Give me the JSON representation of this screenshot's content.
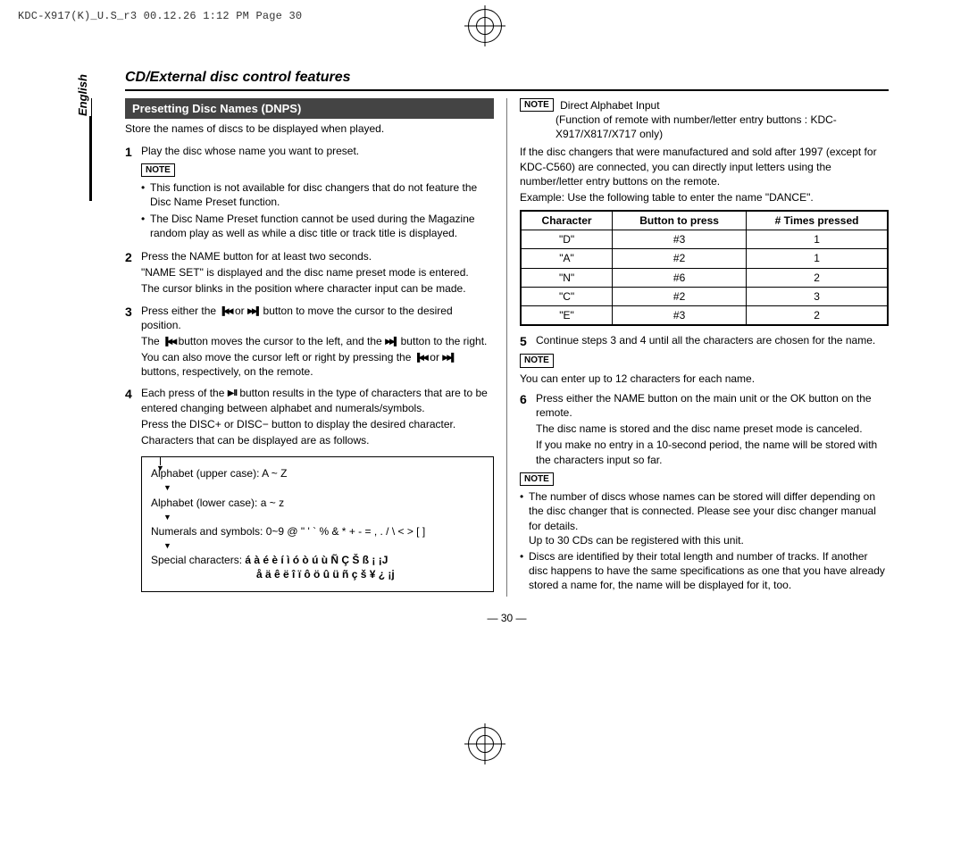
{
  "printmark": "KDC-X917(K)_U.S_r3  00.12.26 1:12 PM  Page 30",
  "language": "English",
  "section_title": "CD/External disc control features",
  "subhead": "Presetting Disc Names (DNPS)",
  "intro": "Store the names of discs to be displayed when played.",
  "note_label": "NOTE",
  "left": {
    "s1": "Play the disc whose name you want to preset.",
    "n1a": "This function is not available for disc changers that do not feature the Disc Name Preset function.",
    "n1b": "The Disc Name Preset function cannot be used during the Magazine random play as well as while a disc title or track title is displayed.",
    "s2a": "Press the NAME button for at least two seconds.",
    "s2b": "\"NAME SET\" is displayed and the disc name preset mode is entered.",
    "s2c": "The cursor blinks in the position where character input can be made.",
    "s3_pre": "Press either the ",
    "s3_mid": " or ",
    "s3_post": " button to move the cursor to the desired position.",
    "s3b_pre": "The ",
    "s3b_mid": " button moves the cursor to the left, and the ",
    "s3b_post": " button to the right.",
    "s3c_pre": "You can also move the cursor left or right by pressing the ",
    "s3c_mid": " or ",
    "s3c_post": " buttons, respectively, on the remote.",
    "s4_pre": "Each press of the ",
    "s4_post": " button results in the type of characters that are to be entered changing between alphabet and numerals/symbols.",
    "s4b": "Press the DISC+ or DISC− button to display the desired character.",
    "s4c": "Characters that can be displayed are as follows.",
    "cb_upper": "Alphabet (upper case): A ~ Z",
    "cb_lower": "Alphabet (lower case): a ~ z",
    "cb_nums": "Numerals and symbols: 0~9 @ \" ' ` % & * + - = , . / \\ < > [ ]",
    "cb_spec": "Special characters:",
    "cb_spec_line1": "á à é è í ì ó ò ú ù Ñ Ç Š ß ¡ ¡J",
    "cb_spec_line2": "å ä ê ë î ï ô ö û ü ñ ç š ¥ ¿ ¡j"
  },
  "right": {
    "dai_title": "Direct Alphabet Input",
    "dai_sub": "(Function of remote with number/letter entry buttons : KDC-X917/X817/X717 only)",
    "dai_p1": "If the disc changers that were manufactured and sold after 1997 (except for KDC-C560) are connected, you can directly input letters using the number/letter entry buttons on the remote.",
    "dai_p2": "Example: Use the following table to enter the name \"DANCE\".",
    "th_char": "Character",
    "th_btn": "Button to press",
    "th_times": "# Times pressed",
    "rows": [
      {
        "c": "\"D\"",
        "b": "#3",
        "t": "1"
      },
      {
        "c": "\"A\"",
        "b": "#2",
        "t": "1"
      },
      {
        "c": "\"N\"",
        "b": "#6",
        "t": "2"
      },
      {
        "c": "\"C\"",
        "b": "#2",
        "t": "3"
      },
      {
        "c": "\"E\"",
        "b": "#3",
        "t": "2"
      }
    ],
    "s5": "Continue steps 3 and 4 until all the characters are chosen for the name.",
    "n5": "You can enter up to 12 characters for each name.",
    "s6a": "Press either the NAME button on the main unit or the OK button on the remote.",
    "s6b": "The disc name is stored and the disc name preset mode is canceled.",
    "s6c": "If you make no entry in a 10-second period, the name will be stored with the characters input so far.",
    "n6a": "The number of discs whose names can be stored will differ depending on the disc changer that is connected. Please see your disc changer manual for details.",
    "n6a2": "Up to 30 CDs can be registered with this unit.",
    "n6b": "Discs are identified by their total length and number of tracks. If another disc happens to have the same specifications as one that you have already stored a name for, the name will be displayed for it, too."
  },
  "pagenum": "— 30 —"
}
